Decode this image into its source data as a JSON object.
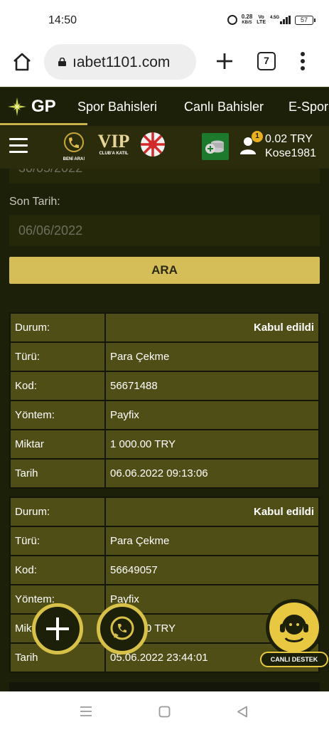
{
  "status_bar": {
    "time": "14:50",
    "net_speed_value": "0.28",
    "net_speed_unit": "KB/S",
    "volte_top": "Vo",
    "volte_bottom": "LTE",
    "network": "4.5G",
    "battery": "57"
  },
  "browser": {
    "url": "ıabet1101.com",
    "tab_count": "7"
  },
  "site_nav": {
    "logo": "GP",
    "items": [
      "Spor Bahisleri",
      "Canlı Bahisler",
      "E-Spor"
    ]
  },
  "sub_header": {
    "beni_ara_label": "BENİ ARA!",
    "vip_text": "VIP",
    "vip_label": "CLUB'A KATIL",
    "notification_count": "1",
    "balance": "0.02 TRY",
    "username": "Kose1981"
  },
  "filters": {
    "start_date_partial": "30/05/2022",
    "end_date_label": "Son Tarih:",
    "end_date_value": "06/06/2022",
    "search_button": "ARA"
  },
  "transactions": [
    {
      "rows": [
        {
          "key": "Durum:",
          "value": "Kabul edildi"
        },
        {
          "key": "Türü:",
          "value": "Para Çekme"
        },
        {
          "key": "Kod:",
          "value": "56671488"
        },
        {
          "key": "Yöntem:",
          "value": "Payfix"
        },
        {
          "key": "Miktar",
          "value": "1 000.00 TRY"
        },
        {
          "key": "Tarih",
          "value": "06.06.2022 09:13:06"
        }
      ]
    },
    {
      "rows": [
        {
          "key": "Durum:",
          "value": "Kabul edildi"
        },
        {
          "key": "Türü:",
          "value": "Para Çekme"
        },
        {
          "key": "Kod:",
          "value": "56649057"
        },
        {
          "key": "Yöntem:",
          "value": "Payfix"
        },
        {
          "key": "Miktar",
          "value": "1 000.00 TRY"
        },
        {
          "key": "Tarih",
          "value": "05.06.2022 23:44:01"
        }
      ]
    }
  ],
  "support": {
    "label": "CANLI DESTEK"
  },
  "colors": {
    "accent": "#d5bd58",
    "background": "#1d2009",
    "row": "#4f4e17"
  }
}
